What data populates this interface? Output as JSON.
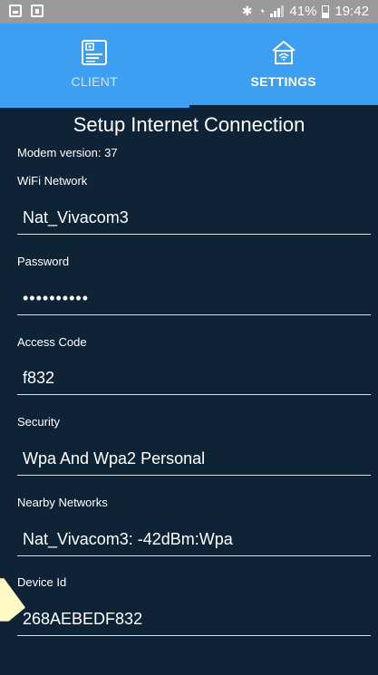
{
  "status_bar": {
    "battery_text": "41%",
    "time": "19:42",
    "icons": [
      "gallery-icon",
      "lock-screen-icon",
      "bluetooth-icon",
      "wifi-icon",
      "signal-icon",
      "battery-icon"
    ]
  },
  "tabs": [
    {
      "label": "CLIENT",
      "icon": "client-icon",
      "active": false
    },
    {
      "label": "SETTINGS",
      "icon": "router-settings-icon",
      "active": true
    }
  ],
  "page": {
    "title": "Setup Internet Connection",
    "modem_version": "Modem version: 37"
  },
  "fields": {
    "wifi_network": {
      "label": "WiFi Network",
      "value": "Nat_Vivacom3"
    },
    "password": {
      "label": "Password",
      "value": "••••••••••"
    },
    "access_code": {
      "label": "Access Code",
      "value": "f832"
    },
    "security": {
      "label": "Security",
      "value": "Wpa And Wpa2 Personal"
    },
    "nearby_networks": {
      "label": "Nearby Networks",
      "value": "Nat_Vivacom3:  -42dBm:Wpa"
    },
    "device_id": {
      "label": "Device Id",
      "value": "268AEBEDF832"
    }
  },
  "colors": {
    "tab_bar": "#3c9ff1",
    "background": "#0f2336",
    "status_bar": "#9a9a9a",
    "field_underline": "#d9dfe6"
  }
}
